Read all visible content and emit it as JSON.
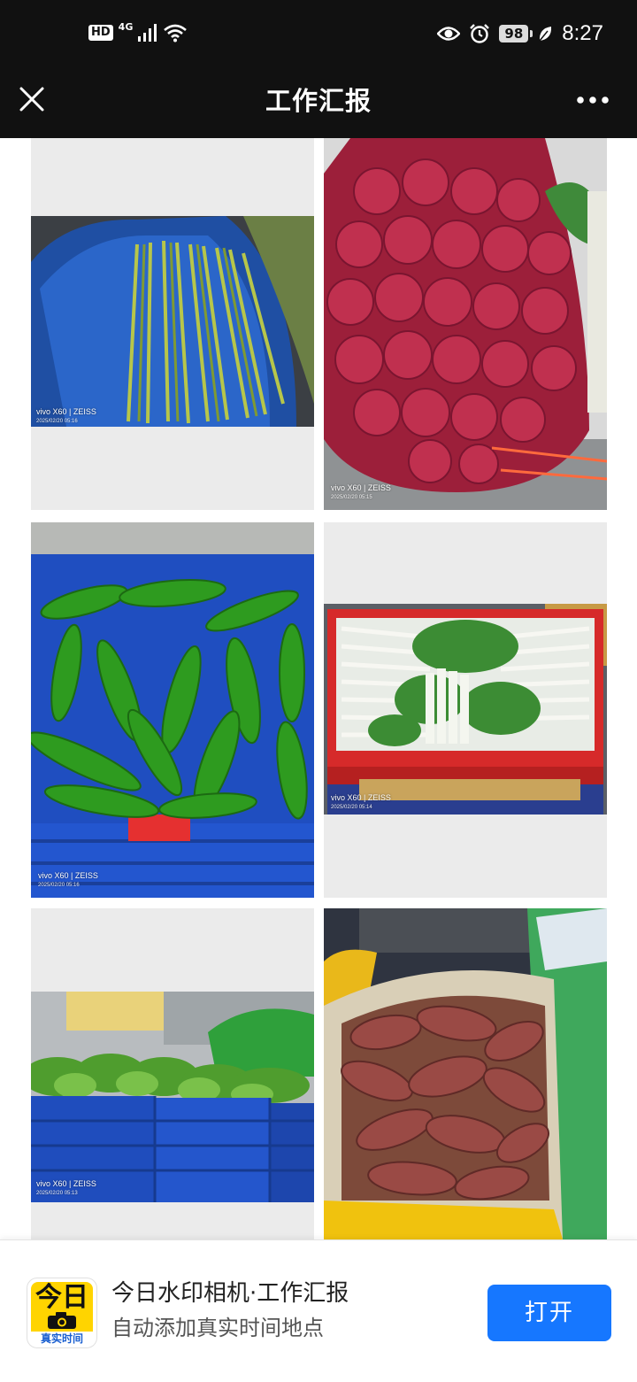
{
  "status_bar": {
    "hd_label": "HD",
    "network_label": "4G",
    "battery_level": "98",
    "time": "8:27"
  },
  "title_bar": {
    "title": "工作汇报"
  },
  "photos": [
    {
      "subject": "garlic scapes",
      "watermark_brand": "vivo X60 | ZEISS",
      "watermark_time": "2025/02/20 05:16"
    },
    {
      "subject": "red onions",
      "watermark_brand": "vivo X60 | ZEISS",
      "watermark_time": "2025/02/20 05:15"
    },
    {
      "subject": "green peppers",
      "watermark_brand": "vivo X60 | ZEISS",
      "watermark_time": "2025/02/20 05:16"
    },
    {
      "subject": "bok choy",
      "watermark_brand": "vivo X60 | ZEISS",
      "watermark_time": "2025/02/20 05:14"
    },
    {
      "subject": "lettuce crates",
      "watermark_brand": "vivo X60 | ZEISS",
      "watermark_time": "2025/02/20 05:13"
    },
    {
      "subject": "sweet potatoes",
      "watermark_brand": "",
      "watermark_time": ""
    }
  ],
  "banner": {
    "logo_main": "今日",
    "logo_sub": "真实时间",
    "app_title": "今日水印相机·工作汇报",
    "app_subtitle": "自动添加真实时间地点",
    "open_label": "打开"
  },
  "colors": {
    "header_bg": "#111111",
    "open_button": "#1677ff",
    "logo_yellow": "#ffd400"
  }
}
